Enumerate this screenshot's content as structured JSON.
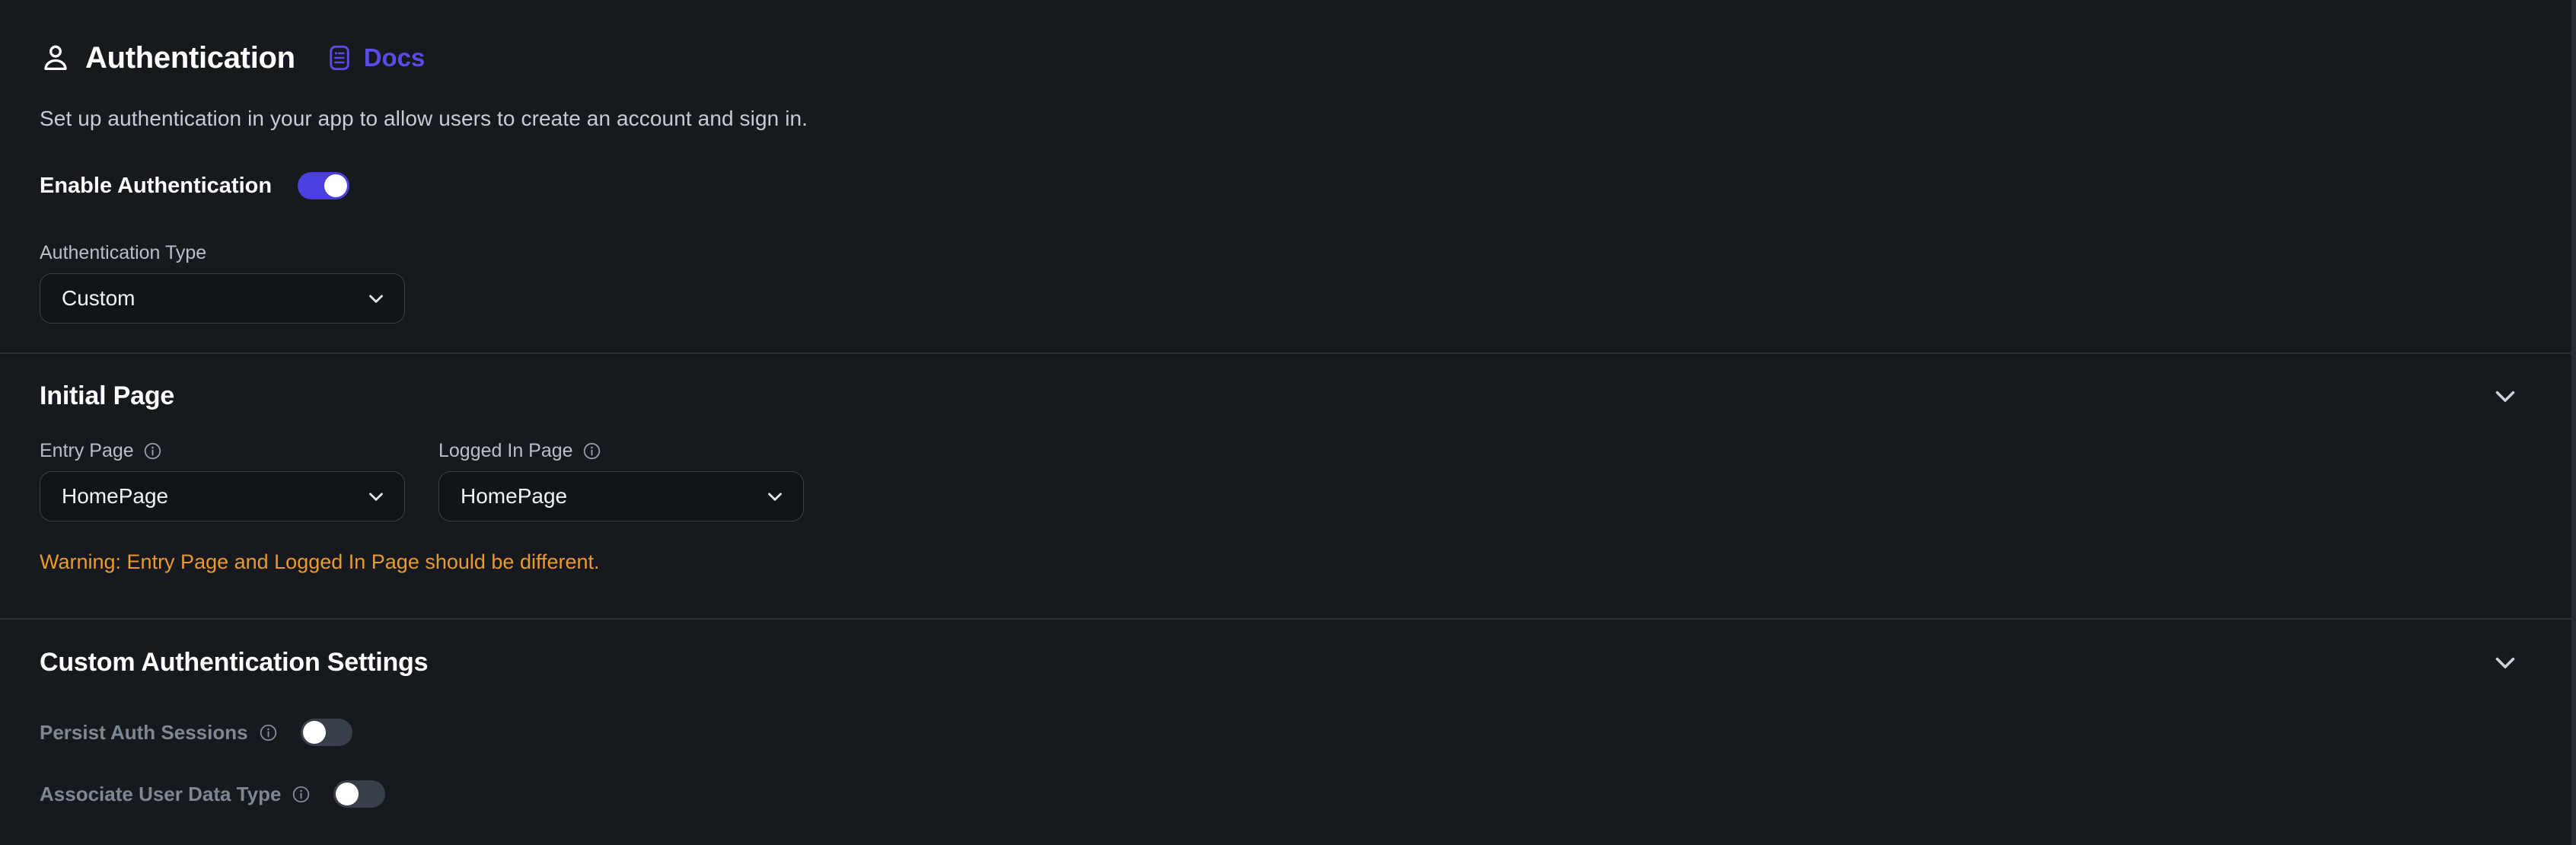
{
  "header": {
    "icon": "person-icon",
    "title": "Authentication",
    "docs": {
      "icon": "document-icon",
      "label": "Docs"
    }
  },
  "description": "Set up authentication in your app to allow users to create an account and sign in.",
  "enable_authentication": {
    "label": "Enable Authentication",
    "toggle_state": "on"
  },
  "authentication_type": {
    "label": "Authentication Type",
    "value": "Custom",
    "chevron": "chevron-down-icon"
  },
  "sections": [
    {
      "title": "Initial Page",
      "collapse_icon": "chevron-down-icon",
      "fields": [
        {
          "label": "Entry Page",
          "info_icon": "info-icon",
          "value": "HomePage",
          "chevron": "chevron-down-icon"
        },
        {
          "label": "Logged In Page",
          "info_icon": "info-icon",
          "value": "HomePage",
          "chevron": "chevron-down-icon"
        }
      ],
      "warning": "Warning: Entry Page and Logged In Page should be different."
    },
    {
      "title": "Custom Authentication Settings",
      "collapse_icon": "chevron-down-icon",
      "settings": [
        {
          "label": "Persist Auth Sessions",
          "info_icon": "info-icon",
          "toggle_state": "off"
        },
        {
          "label": "Associate User Data Type",
          "info_icon": "info-icon",
          "toggle_state": "off"
        }
      ]
    }
  ],
  "colors": {
    "background": "#16191e",
    "accent_purple": "#5b4ce8",
    "toggle_on": "#4b3fe0",
    "toggle_off": "#3a4049",
    "warning_orange": "#eb9a2e",
    "divider": "#2c323a",
    "muted_text": "#7f8794"
  }
}
